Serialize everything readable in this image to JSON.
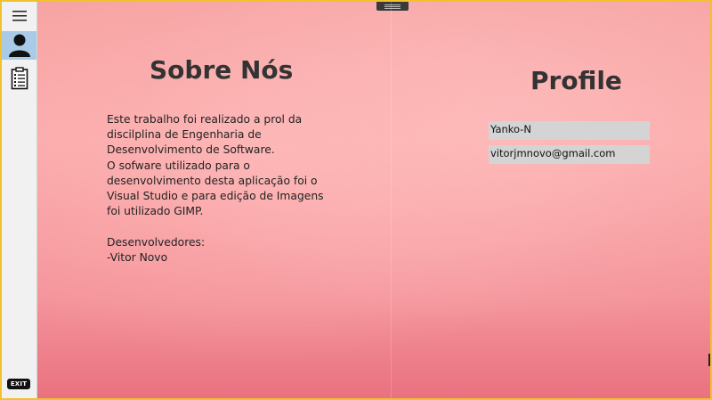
{
  "sidebar": {
    "menu_icon": "hamburger-icon",
    "profile_icon": "user-icon",
    "document_icon": "document-list-icon",
    "exit_label": "EXIT"
  },
  "about": {
    "title": "Sobre Nós",
    "text": "   Este trabalho foi realizado a prol da discilplina de Engenharia de Desenvolvimento de Software.\n   O sofware utilizado para o desenvolvimento desta aplicação foi o Visual Studio e para edição de Imagens foi utilizado GIMP.\n\nDesenvolvedores:\n              -Vitor Novo"
  },
  "profile": {
    "title": "Profile",
    "username": "Yanko-N",
    "email": "vitorjmnovo@gmail.com"
  },
  "colors": {
    "frame": "#f2c12e",
    "sidebar_bg": "#f1f1f1",
    "selected_bg": "#a9cbe8",
    "field_bg": "#d4d4d4",
    "background_top": "#f7a3a3",
    "background_bottom": "#e9727f"
  }
}
